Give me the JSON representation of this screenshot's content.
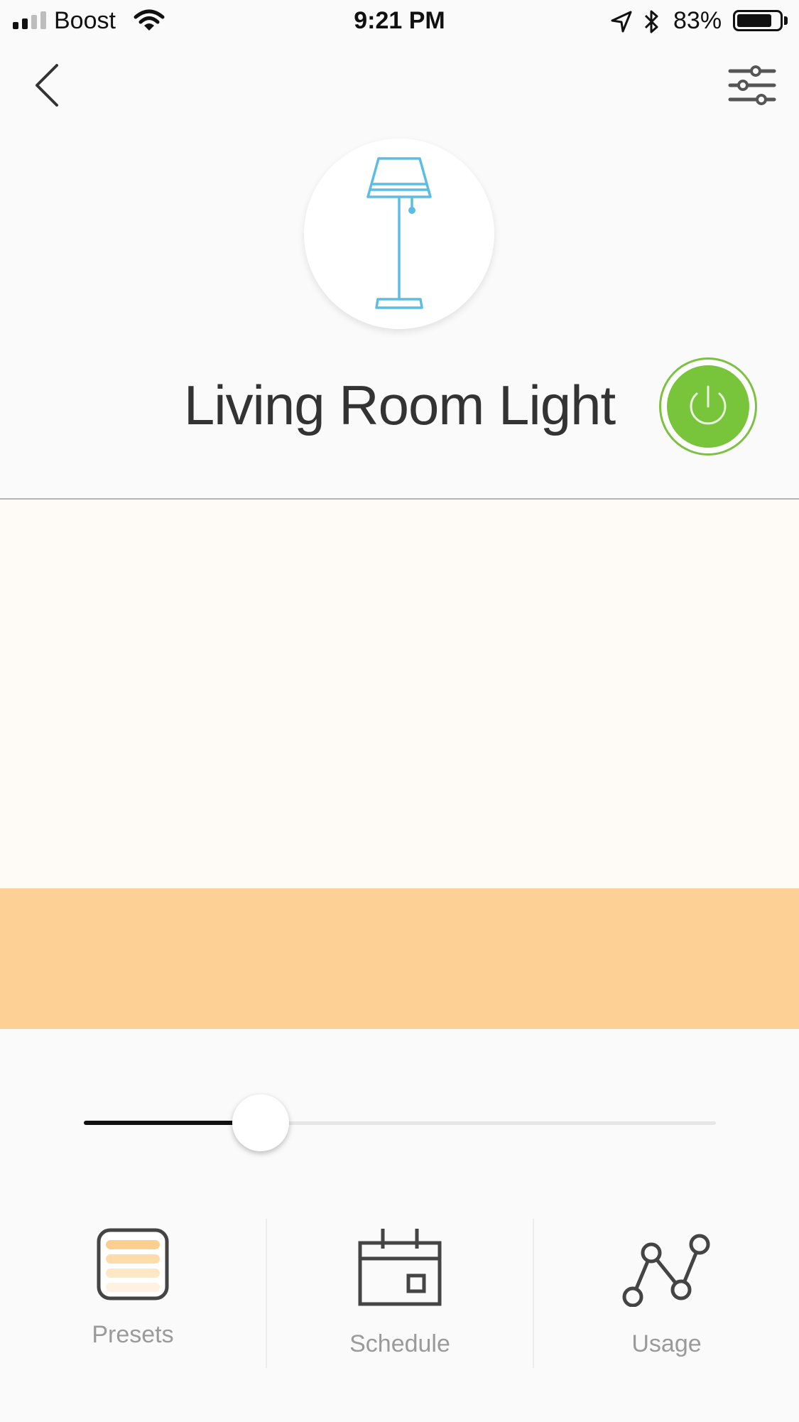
{
  "status_bar": {
    "carrier": "Boost",
    "time": "9:21 PM",
    "battery_percent": "83%",
    "battery_level": 0.83,
    "signal_bars": 4,
    "signal_active_bars": 2,
    "icons": [
      "signal-icon",
      "wifi-icon",
      "location-arrow-icon",
      "bluetooth-icon",
      "battery-icon"
    ]
  },
  "header": {
    "back_icon": "chevron-left-icon",
    "settings_icon": "sliders-icon"
  },
  "device": {
    "name": "Living Room Light",
    "icon": "floor-lamp-icon",
    "power_state": "on",
    "power_icon": "power-icon"
  },
  "colors": {
    "accent_lamp": "#5bbde3",
    "power_on": "#78c43a",
    "preview_background": "#fefaf5",
    "light_color": "#fdd096",
    "preset_stripe": "#fdd096"
  },
  "brightness_slider": {
    "level": 0.28
  },
  "tabs": [
    {
      "label": "Presets",
      "icon": "presets-icon",
      "active": true
    },
    {
      "label": "Schedule",
      "icon": "calendar-icon",
      "active": false
    },
    {
      "label": "Usage",
      "icon": "usage-graph-icon",
      "active": false
    }
  ]
}
